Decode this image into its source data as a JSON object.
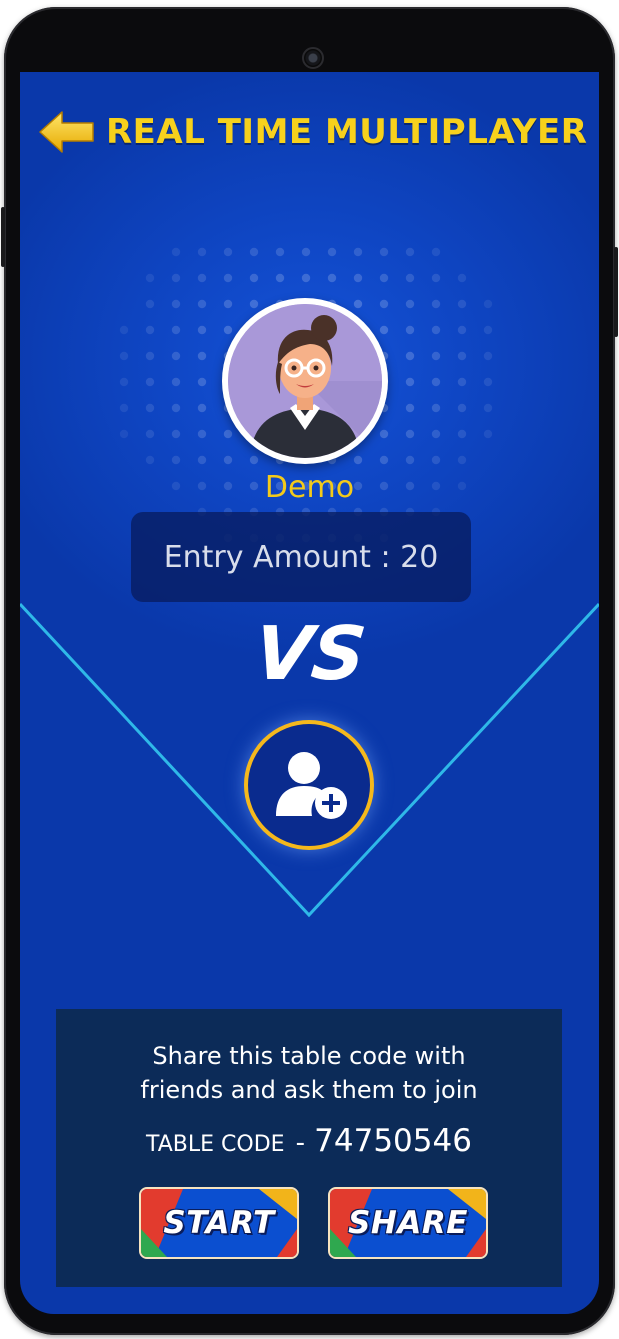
{
  "header": {
    "title": "REAL TIME MULTIPLAYER",
    "back_icon": "arrow-left-icon"
  },
  "player": {
    "name": "Demo",
    "avatar_icon": "woman-avatar-icon"
  },
  "entry": {
    "text": "Entry Amount : 20"
  },
  "versus": {
    "label": "VS"
  },
  "join": {
    "icon": "add-user-icon"
  },
  "share_panel": {
    "message_line1": "Share this table code with",
    "message_line2": "friends and ask them to join",
    "code_label": "TABLE CODE",
    "code_separator": "-",
    "code_value": "74750546",
    "start_label": "START",
    "share_label": "SHARE"
  },
  "colors": {
    "accent_yellow": "#f7d11c",
    "background_blue": "#0f46c4",
    "panel_navy": "#0c2b58",
    "line_cyan": "#2fb8e8"
  }
}
